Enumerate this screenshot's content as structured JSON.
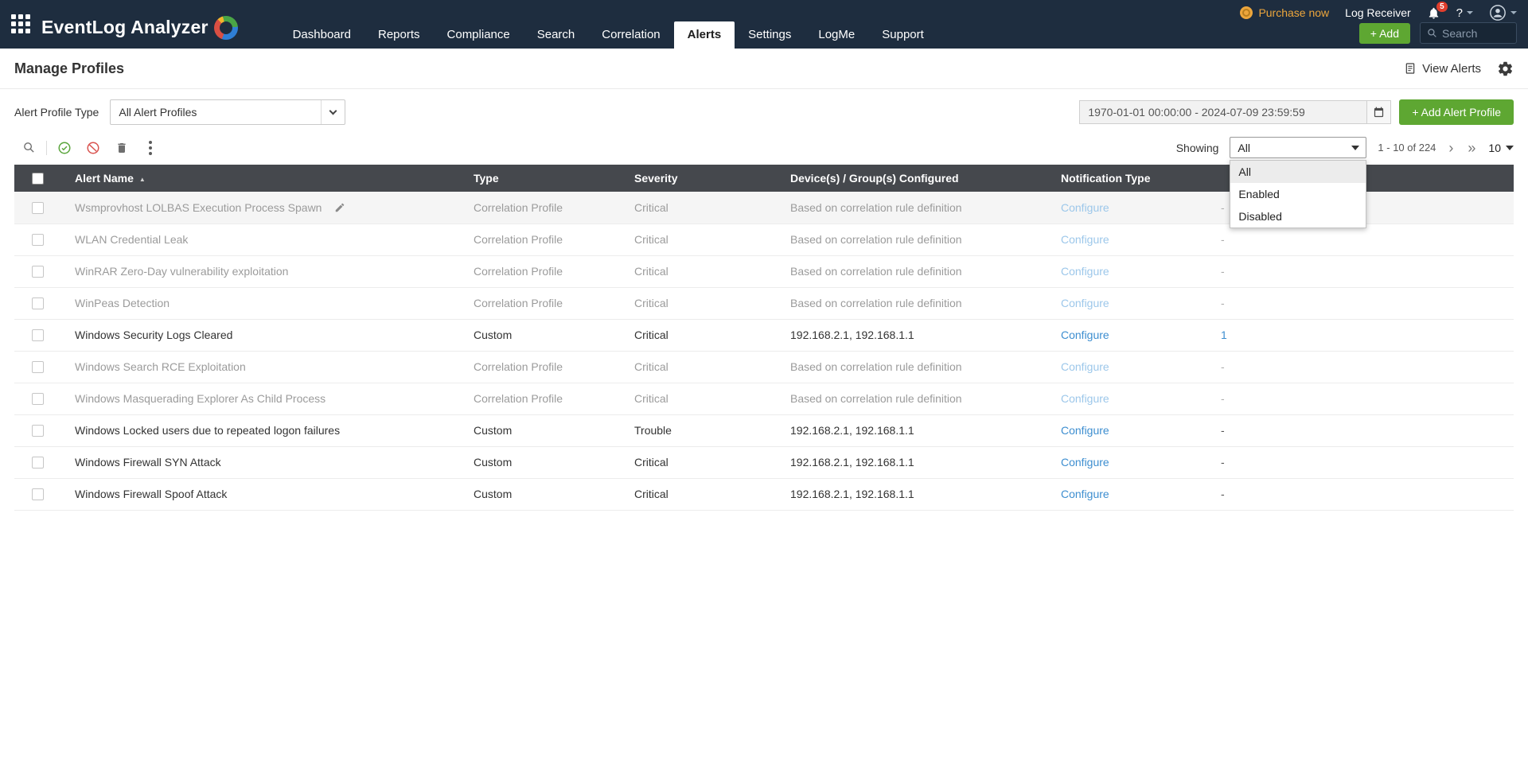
{
  "brand": {
    "product_name": "EventLog Analyzer"
  },
  "topbar": {
    "purchase_now": "Purchase now",
    "log_receiver": "Log Receiver",
    "notification_badge": "5",
    "help_label": "?",
    "add_button": "+ Add",
    "search_placeholder": "Search"
  },
  "nav": {
    "items": [
      {
        "label": "Dashboard",
        "active": false
      },
      {
        "label": "Reports",
        "active": false
      },
      {
        "label": "Compliance",
        "active": false
      },
      {
        "label": "Search",
        "active": false
      },
      {
        "label": "Correlation",
        "active": false
      },
      {
        "label": "Alerts",
        "active": true
      },
      {
        "label": "Settings",
        "active": false
      },
      {
        "label": "LogMe",
        "active": false
      },
      {
        "label": "Support",
        "active": false
      }
    ]
  },
  "page": {
    "title": "Manage Profiles",
    "view_alerts_label": "View Alerts"
  },
  "filters": {
    "profile_type_label": "Alert Profile Type",
    "profile_type_value": "All Alert Profiles",
    "date_range_value": "1970-01-01 00:00:00 - 2024-07-09 23:59:59",
    "add_alert_profile_label": "+ Add Alert Profile"
  },
  "toolbar": {
    "showing_label": "Showing",
    "showing_value": "All",
    "showing_options": [
      "All",
      "Enabled",
      "Disabled"
    ],
    "pagination_text": "1 - 10 of 224",
    "page_size": "10"
  },
  "icons": {
    "sort_asc": "▲",
    "next_page": "›",
    "last_page": "»"
  },
  "table": {
    "headers": [
      "Alert Name",
      "Type",
      "Severity",
      "Device(s) / Group(s) Configured",
      "Notification Type",
      ""
    ],
    "configure_label": "Configure",
    "rows": [
      {
        "name": "Wsmprovhost LOLBAS Execution Process Spawn",
        "type": "Correlation Profile",
        "severity": "Critical",
        "devices": "Based on correlation rule definition",
        "count": "-",
        "disabled": true,
        "hover": true
      },
      {
        "name": "WLAN Credential Leak",
        "type": "Correlation Profile",
        "severity": "Critical",
        "devices": "Based on correlation rule definition",
        "count": "-",
        "disabled": true,
        "hover": false
      },
      {
        "name": "WinRAR Zero-Day vulnerability exploitation",
        "type": "Correlation Profile",
        "severity": "Critical",
        "devices": "Based on correlation rule definition",
        "count": "-",
        "disabled": true,
        "hover": false
      },
      {
        "name": "WinPeas Detection",
        "type": "Correlation Profile",
        "severity": "Critical",
        "devices": "Based on correlation rule definition",
        "count": "-",
        "disabled": true,
        "hover": false
      },
      {
        "name": "Windows Security Logs Cleared",
        "type": "Custom",
        "severity": "Critical",
        "devices": "192.168.2.1, 192.168.1.1",
        "count": "1",
        "disabled": false,
        "hover": false
      },
      {
        "name": "Windows Search RCE Exploitation",
        "type": "Correlation Profile",
        "severity": "Critical",
        "devices": "Based on correlation rule definition",
        "count": "-",
        "disabled": true,
        "hover": false
      },
      {
        "name": "Windows Masquerading Explorer As Child Process",
        "type": "Correlation Profile",
        "severity": "Critical",
        "devices": "Based on correlation rule definition",
        "count": "-",
        "disabled": true,
        "hover": false
      },
      {
        "name": "Windows Locked users due to repeated logon failures",
        "type": "Custom",
        "severity": "Trouble",
        "devices": "192.168.2.1, 192.168.1.1",
        "count": "-",
        "disabled": false,
        "hover": false
      },
      {
        "name": "Windows Firewall SYN Attack",
        "type": "Custom",
        "severity": "Critical",
        "devices": "192.168.2.1, 192.168.1.1",
        "count": "-",
        "disabled": false,
        "hover": false
      },
      {
        "name": "Windows Firewall Spoof Attack",
        "type": "Custom",
        "severity": "Critical",
        "devices": "192.168.2.1, 192.168.1.1",
        "count": "-",
        "disabled": false,
        "hover": false
      }
    ]
  },
  "colors": {
    "navbar_bg": "#1e2d3f",
    "accent_green": "#5ea732",
    "table_header_bg": "#45484d",
    "link_blue": "#3d8ed0",
    "disabled_text": "#9b9b9b",
    "badge_red": "#e03e2d",
    "purchase_orange": "#eda63c"
  }
}
